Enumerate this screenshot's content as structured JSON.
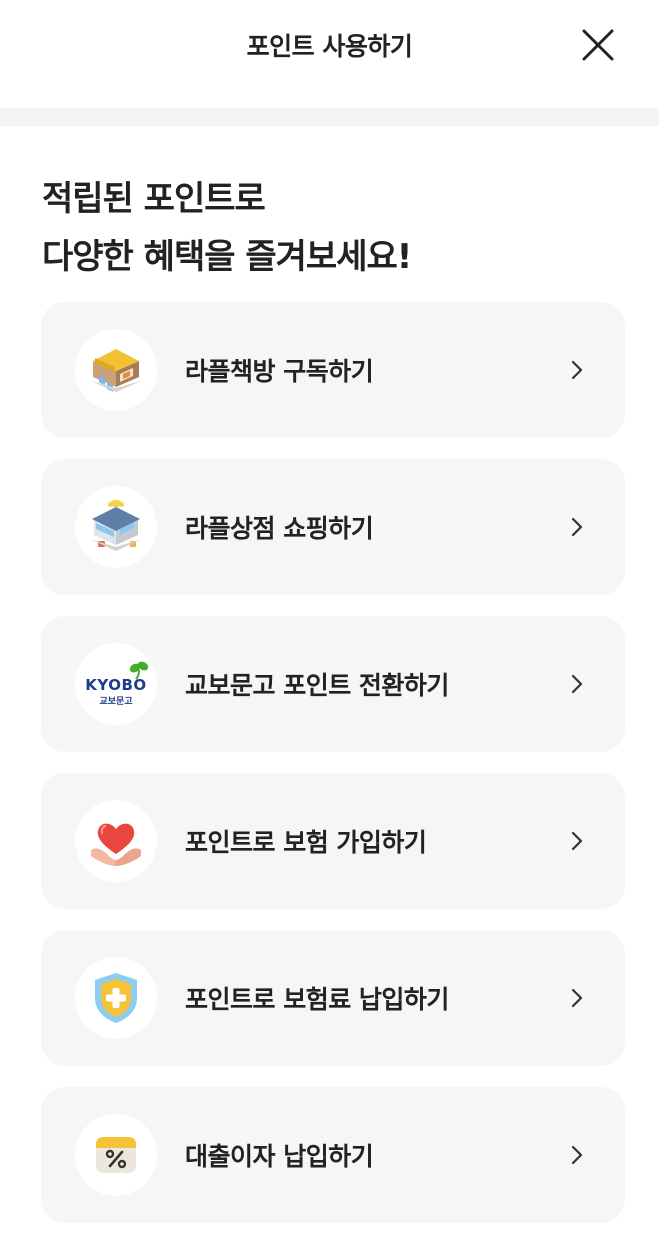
{
  "header": {
    "title": "포인트 사용하기"
  },
  "headline": {
    "line1": "적립된 포인트로",
    "line2": "다양한 혜택을 즐겨보세요!"
  },
  "menu": [
    {
      "label": "라플책방 구독하기",
      "icon": "bookstore-icon"
    },
    {
      "label": "라플상점 쇼핑하기",
      "icon": "shop-icon"
    },
    {
      "label": "교보문고 포인트 전환하기",
      "icon": "kyobo-logo",
      "logo_text": "KYOBO",
      "logo_sub": "교보문고"
    },
    {
      "label": "포인트로 보험 가입하기",
      "icon": "heart-hands-icon"
    },
    {
      "label": "포인트로 보험료 납입하기",
      "icon": "shield-plus-icon"
    },
    {
      "label": "대출이자 납입하기",
      "icon": "percent-calendar-icon"
    }
  ],
  "colors": {
    "card_bg": "#f6f6f6",
    "divider": "#f4f4f4",
    "kyobo_blue": "#1d3c8f",
    "kyobo_green": "#3fae2a"
  }
}
